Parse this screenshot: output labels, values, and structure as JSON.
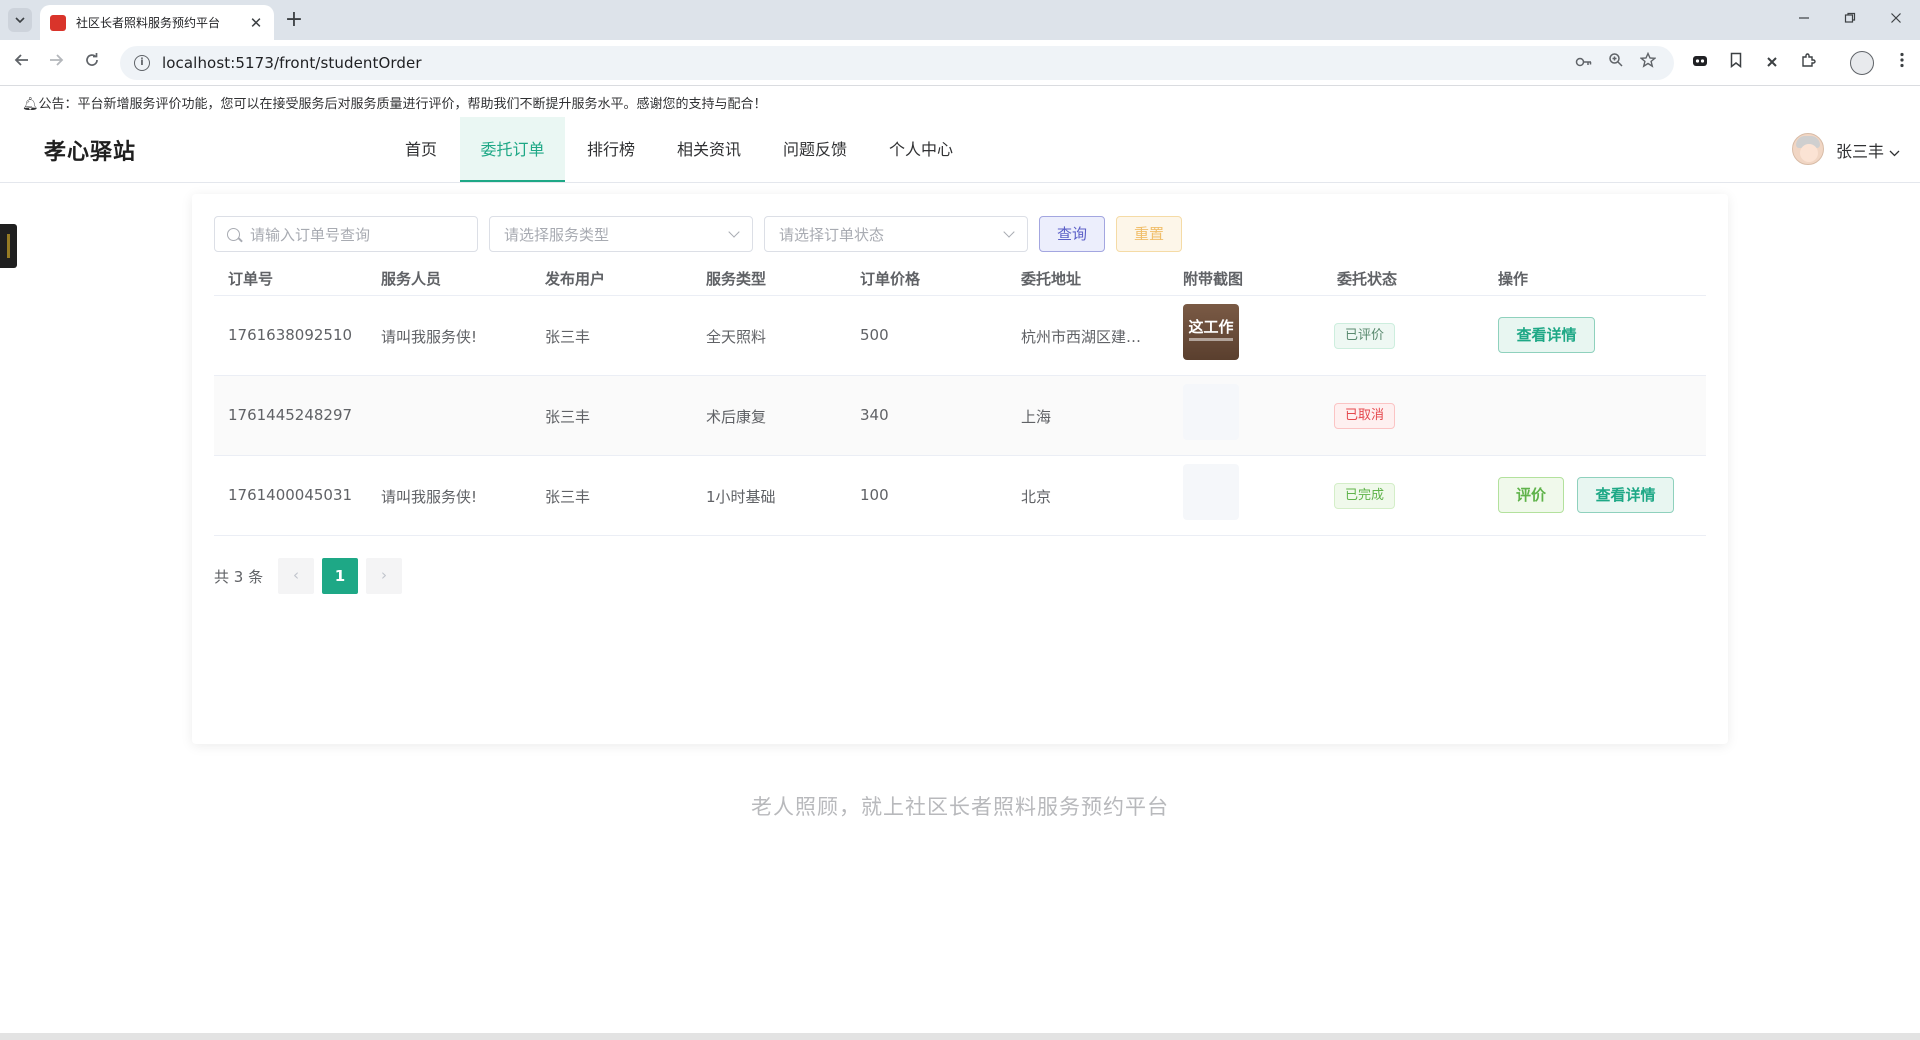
{
  "browser": {
    "tab_title": "社区长者照料服务预约平台",
    "tab_close": "✕",
    "new_tab": "+",
    "url": "localhost:5173/front/studentOrder"
  },
  "notice": "公告：平台新增服务评价功能，您可以在接受服务后对服务质量进行评价，帮助我们不断提升服务水平。感谢您的支持与配合！",
  "header": {
    "logo": "孝心驿站",
    "nav": [
      "首页",
      "委托订单",
      "排行榜",
      "相关资讯",
      "问题反馈",
      "个人中心"
    ],
    "active_nav": "委托订单",
    "user_name": "张三丰"
  },
  "filters": {
    "order_no_placeholder": "请输入订单号查询",
    "service_type_placeholder": "请选择服务类型",
    "status_placeholder": "请选择订单状态",
    "query_label": "查询",
    "reset_label": "重置"
  },
  "table": {
    "columns": [
      "订单号",
      "服务人员",
      "发布用户",
      "服务类型",
      "订单价格",
      "委托地址",
      "附带截图",
      "委托状态",
      "操作"
    ],
    "rows": [
      {
        "order_no": "1761638092510",
        "staff": "请叫我服务侠!",
        "user": "张三丰",
        "service": "全天照料",
        "price": "500",
        "address": "杭州市西湖区建…",
        "image_text": "这工作",
        "status": "已评价",
        "actions": [
          "查看详情"
        ]
      },
      {
        "order_no": "1761445248297",
        "staff": "",
        "user": "张三丰",
        "service": "术后康复",
        "price": "340",
        "address": "上海",
        "image_text": "",
        "status": "已取消",
        "actions": []
      },
      {
        "order_no": "1761400045031",
        "staff": "请叫我服务侠!",
        "user": "张三丰",
        "service": "1小时基础",
        "price": "100",
        "address": "北京",
        "image_text": "",
        "status": "已完成",
        "actions": [
          "评价",
          "查看详情"
        ]
      }
    ]
  },
  "pagination": {
    "total_text": "共 3 条",
    "current_page": "1",
    "prev": "‹",
    "next": "›"
  },
  "footer": "老人照顾，就上社区长者照料服务预约平台",
  "colors": {
    "accent": "#1ea886",
    "query": "#5b5fc7",
    "reset": "#f0be6a",
    "danger": "#e5484d",
    "success": "#5fb34a"
  }
}
